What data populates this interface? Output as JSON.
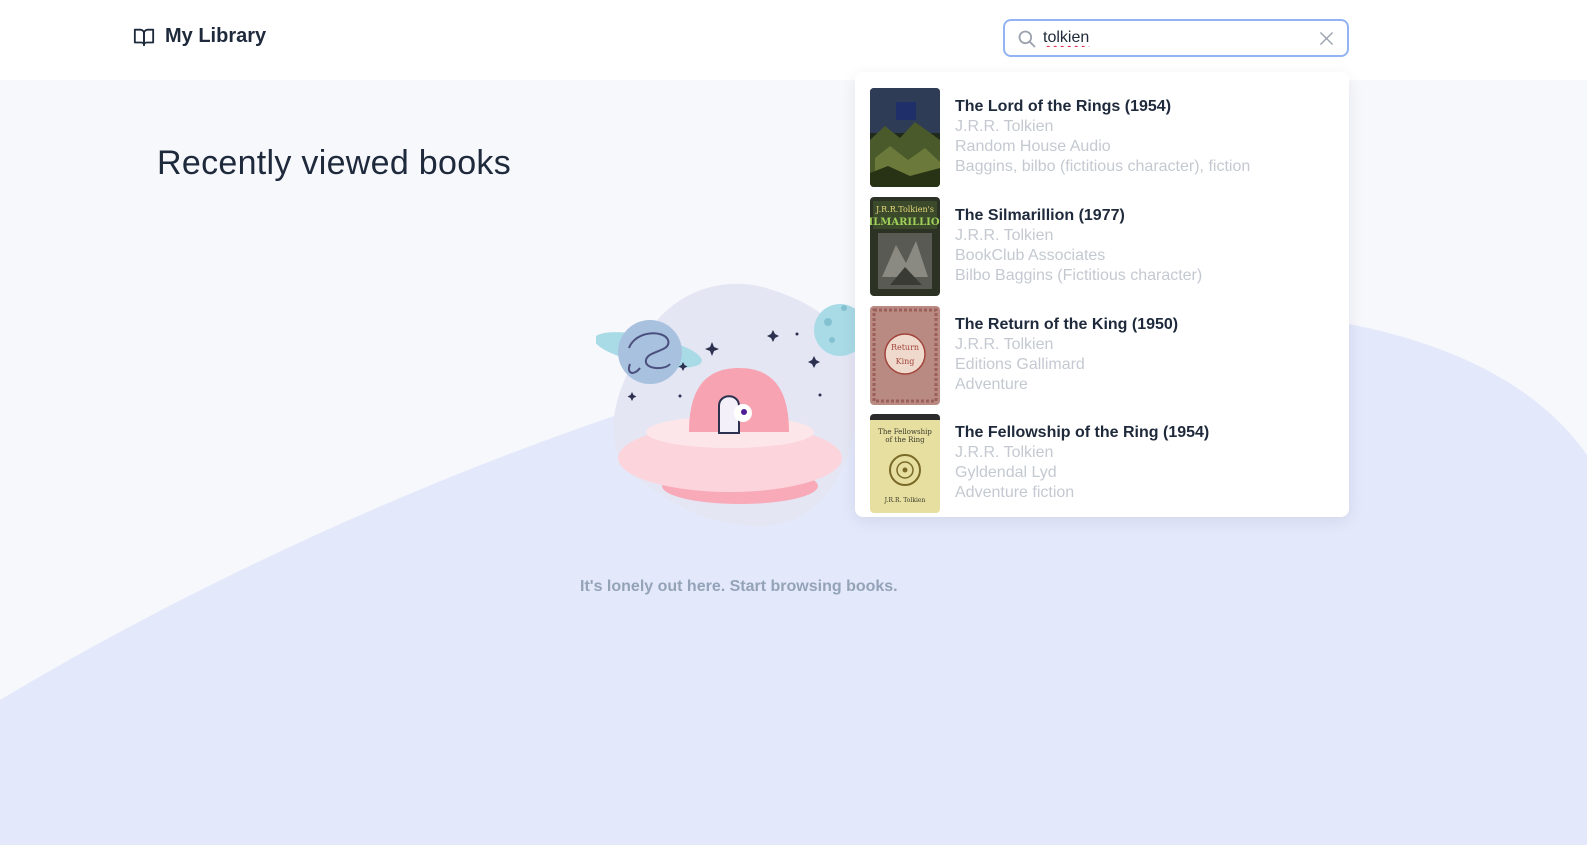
{
  "brand": {
    "label": "My Library",
    "icon": "open-book-icon"
  },
  "search": {
    "value": "tolkien",
    "icon": "search-icon",
    "clear_icon": "close-icon"
  },
  "main": {
    "heading": "Recently viewed books",
    "empty_message": "It's lonely out here. Start browsing books."
  },
  "results": [
    {
      "title": "The Lord of the Rings (1954)",
      "author": "J.R.R. Tolkien",
      "publisher": "Random House Audio",
      "subjects": "Baggins, bilbo (fictitious character), fiction"
    },
    {
      "title": "The Silmarillion (1977)",
      "author": "J.R.R. Tolkien",
      "publisher": "BookClub Associates",
      "subjects": "Bilbo Baggins (Fictitious character)"
    },
    {
      "title": "The Return of the King (1950)",
      "author": "J.R.R. Tolkien",
      "publisher": "Editions Gallimard",
      "subjects": "Adventure"
    },
    {
      "title": "The Fellowship of the Ring (1954)",
      "author": "J.R.R. Tolkien",
      "publisher": "Gyldendal Lyd",
      "subjects": "Adventure fiction"
    }
  ],
  "colors": {
    "background": "#f7f8fc",
    "wave": "#e3e8fb",
    "search_border": "#93b4f2",
    "muted_text": "#c4c9d1"
  }
}
